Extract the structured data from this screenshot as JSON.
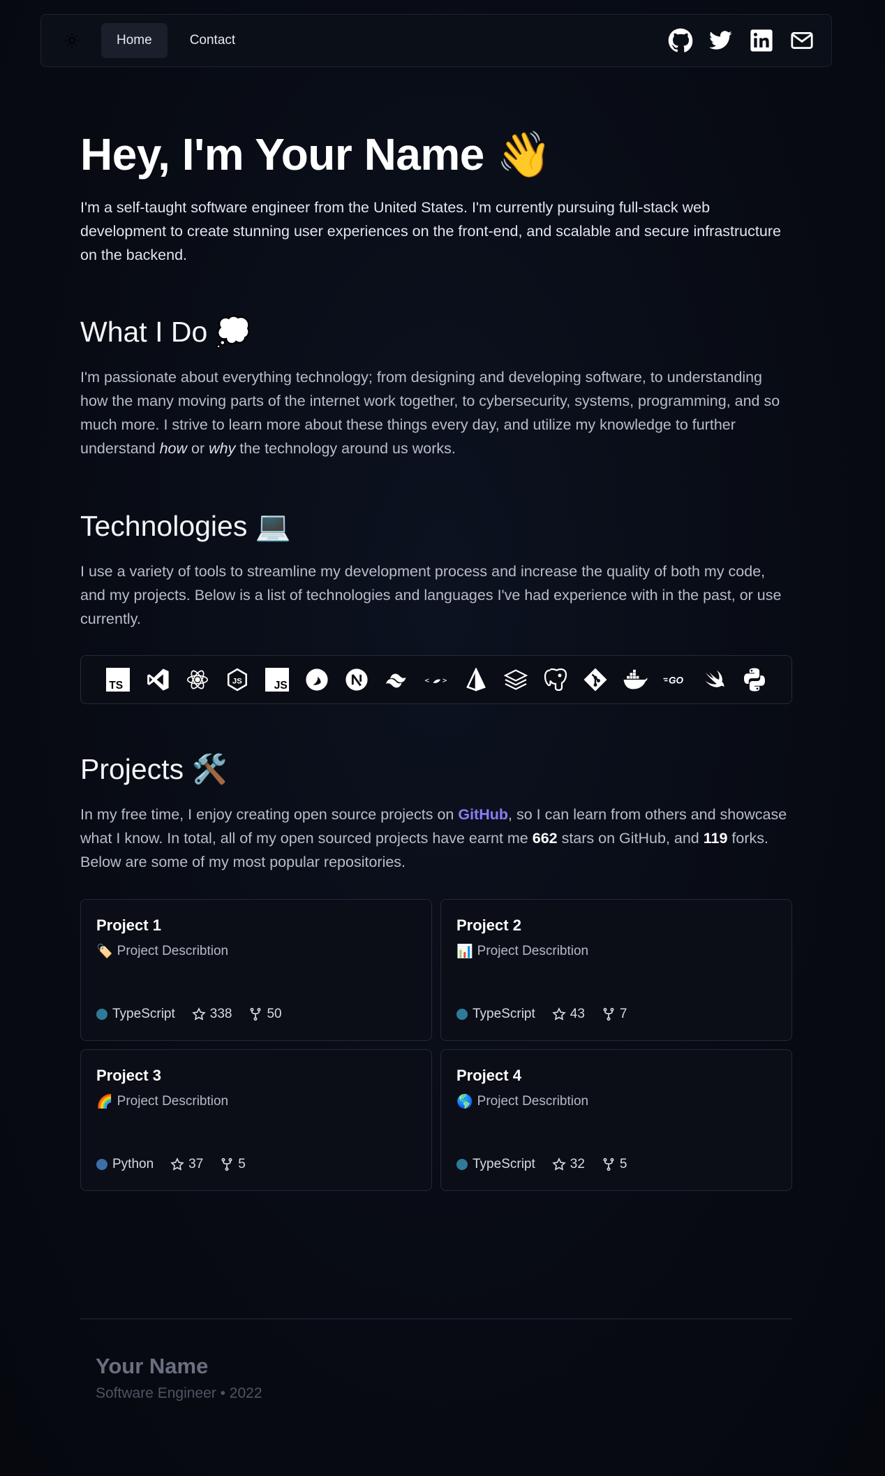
{
  "nav": {
    "links": [
      "Home",
      "Contact"
    ],
    "active": "Home",
    "theme_icon": "sun-icon",
    "social_icons": [
      "github-icon",
      "twitter-icon",
      "linkedin-icon",
      "mail-icon"
    ]
  },
  "hero": {
    "title": "Hey, I'm Your Name 👋",
    "intro": "I'm a self-taught software engineer from the United States. I'm currently pursuing full-stack web development to create stunning user experiences on the front-end, and scalable and secure infrastructure on the backend."
  },
  "what_i_do": {
    "heading": "What I Do 💭",
    "text_1": "I'm passionate about everything technology; from designing and developing software, to understanding how the many moving parts of the internet work together, to cybersecurity, systems, programming, and so much more. I strive to learn more about these things every day, and utilize my knowledge to further understand ",
    "em_1": "how",
    "text_2": " or ",
    "em_2": "why",
    "text_3": " the technology around us works."
  },
  "technologies": {
    "heading": "Technologies 💻",
    "text": "I use a variety of tools to streamline my development process and increase the quality of both my code, and my projects. Below is a list of technologies and languages I've had experience with in the past, or use currently.",
    "icons": [
      "typescript-icon",
      "vscode-icon",
      "react-icon",
      "nodejs-icon",
      "javascript-icon",
      "gatsby-icon",
      "nextjs-icon",
      "tailwind-icon",
      "astro-icon",
      "prisma-icon",
      "stack-icon",
      "postgresql-icon",
      "git-icon",
      "docker-icon",
      "go-icon",
      "swift-icon",
      "python-icon"
    ]
  },
  "projects": {
    "heading": "Projects 🛠️",
    "text_1": "In my free time, I enjoy creating open source projects on ",
    "github_link": "GitHub",
    "text_2": ", so I can learn from others and showcase what I know. In total, all of my open sourced projects have earnt me ",
    "stars": "662",
    "text_3": " stars on GitHub, and ",
    "forks": "119",
    "text_4": " forks. Below are some of my most popular repositories.",
    "cards": [
      {
        "title": "Project 1",
        "emoji": "🏷️",
        "desc": "Project Describtion",
        "lang": "TypeScript",
        "lang_color": "#2f7a9a",
        "stars": "338",
        "forks": "50"
      },
      {
        "title": "Project 2",
        "emoji": "📊",
        "desc": "Project Describtion",
        "lang": "TypeScript",
        "lang_color": "#2f7a9a",
        "stars": "43",
        "forks": "7"
      },
      {
        "title": "Project 3",
        "emoji": "🌈",
        "desc": "Project Describtion",
        "lang": "Python",
        "lang_color": "#3b6fa8",
        "stars": "37",
        "forks": "5"
      },
      {
        "title": "Project 4",
        "emoji": "🌎",
        "desc": "Project Describtion",
        "lang": "TypeScript",
        "lang_color": "#2f7a9a",
        "stars": "32",
        "forks": "5"
      }
    ]
  },
  "footer": {
    "name": "Your Name",
    "subtitle": "Software Engineer • 2022"
  }
}
